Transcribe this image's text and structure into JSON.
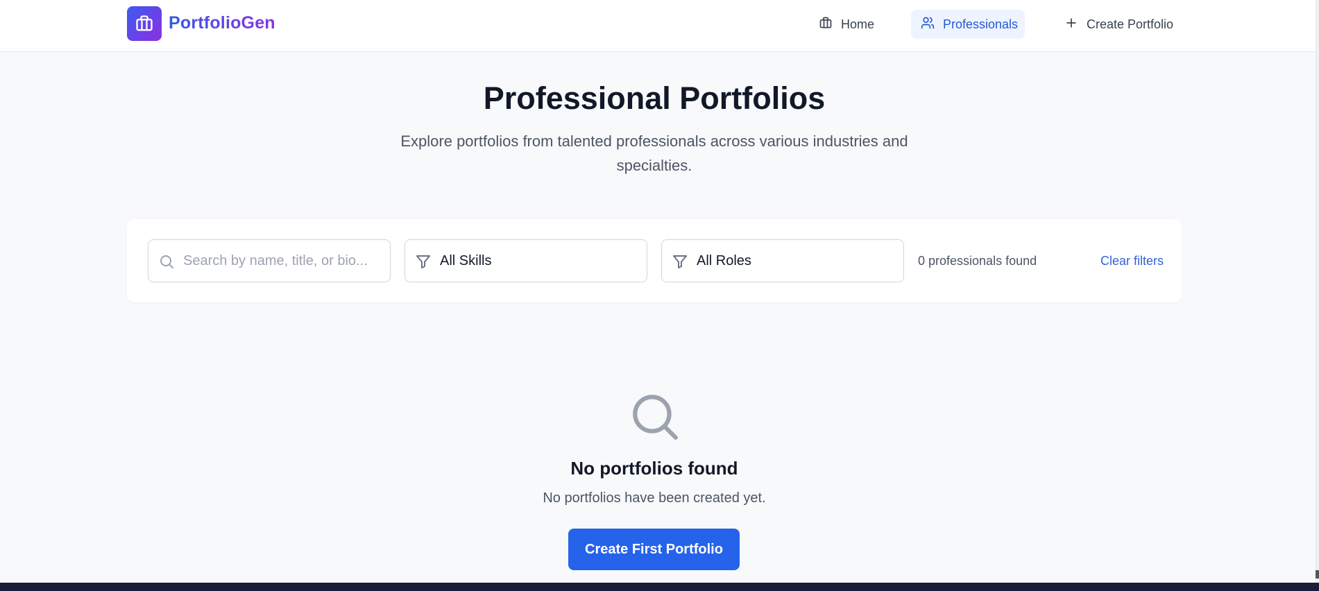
{
  "app": {
    "name": "PortfolioGen",
    "logo_icon": "briefcase-icon",
    "accent": "#2563eb",
    "logo_gradient": [
      "#3b5cf0",
      "#8b2fe0"
    ]
  },
  "nav": {
    "home": {
      "label": "Home",
      "icon": "building-icon"
    },
    "professionals": {
      "label": "Professionals",
      "icon": "users-icon",
      "active": true
    },
    "create": {
      "label": "Create Portfolio",
      "icon": "plus-icon"
    }
  },
  "hero": {
    "title": "Professional Portfolios",
    "subtitle": "Explore portfolios from talented professionals across various industries and specialties."
  },
  "filters": {
    "search": {
      "placeholder": "Search by name, title, or bio...",
      "value": "",
      "icon": "search-icon"
    },
    "skills": {
      "selected": "All Skills",
      "icon": "filter-icon"
    },
    "roles": {
      "selected": "All Roles",
      "icon": "filter-icon"
    },
    "result_count": "0 professionals found",
    "clear_label": "Clear filters"
  },
  "empty_state": {
    "icon": "search-icon",
    "title": "No portfolios found",
    "message": "No portfolios have been created yet.",
    "button_label": "Create First Portfolio"
  }
}
